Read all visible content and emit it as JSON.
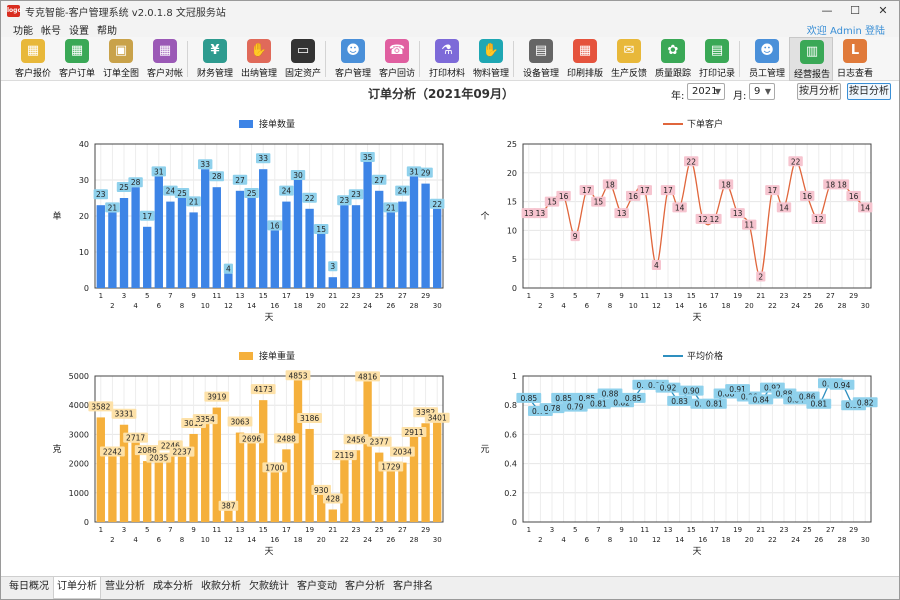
{
  "window": {
    "title": "专克智能-客户管理系统 v2.0.1.8 文冠服务站",
    "logo": "logo"
  },
  "menu": {
    "items": [
      "功能",
      "帐号",
      "设置",
      "帮助"
    ],
    "welcome": "欢迎 Admin 登陆"
  },
  "toolbar": [
    {
      "label": "客户报价",
      "icon": "quote-icon",
      "color": "#e8b83a",
      "glyph": "▦"
    },
    {
      "label": "客户订单",
      "icon": "order-icon",
      "color": "#3aa856",
      "glyph": "▦"
    },
    {
      "label": "订单全图",
      "icon": "image-icon",
      "color": "#c9a24a",
      "glyph": "▣"
    },
    {
      "label": "客户对帐",
      "icon": "ledger-icon",
      "color": "#9b59b6",
      "glyph": "▦"
    },
    {
      "label": "财务管理",
      "icon": "finance-icon",
      "color": "#2e9b8f",
      "glyph": "¥"
    },
    {
      "label": "出纳管理",
      "icon": "cashier-icon",
      "color": "#e06a5a",
      "glyph": "✋"
    },
    {
      "label": "固定资产",
      "icon": "asset-icon",
      "color": "#333333",
      "glyph": "▭"
    },
    {
      "label": "客户管理",
      "icon": "customer-icon",
      "color": "#4a90d9",
      "glyph": "☻"
    },
    {
      "label": "客户回访",
      "icon": "visit-icon",
      "color": "#e05fa0",
      "glyph": "☎"
    },
    {
      "label": "打印材料",
      "icon": "flask-icon",
      "color": "#7d6ad8",
      "glyph": "⚗"
    },
    {
      "label": "物料管理",
      "icon": "glove-icon",
      "color": "#1fa7b3",
      "glyph": "✋"
    },
    {
      "label": "设备管理",
      "icon": "device-icon",
      "color": "#666666",
      "glyph": "▤"
    },
    {
      "label": "印刷排版",
      "icon": "layout-icon",
      "color": "#e5533d",
      "glyph": "▦"
    },
    {
      "label": "生产反馈",
      "icon": "feedback-icon",
      "color": "#e8b83a",
      "glyph": "✉"
    },
    {
      "label": "质量跟踪",
      "icon": "quality-icon",
      "color": "#3aa856",
      "glyph": "✿"
    },
    {
      "label": "打印记录",
      "icon": "record-icon",
      "color": "#3aa856",
      "glyph": "▤"
    },
    {
      "label": "员工管理",
      "icon": "staff-icon",
      "color": "#4a90d9",
      "glyph": "☻"
    },
    {
      "label": "经营报告",
      "icon": "report-icon",
      "color": "#3aa856",
      "glyph": "▥"
    },
    {
      "label": "日志查看",
      "icon": "log-icon",
      "color": "#e07a3a",
      "glyph": "L"
    }
  ],
  "page": {
    "title": "订单分析（2021年09月）",
    "year_label": "年:",
    "year_value": "2021",
    "month_label": "月:",
    "month_value": "9",
    "btn_month": "按月分析",
    "btn_day": "按日分析"
  },
  "tabs": [
    "每日概况",
    "订单分析",
    "营业分析",
    "成本分析",
    "收款分析",
    "欠款统计",
    "客户变动",
    "客户分析",
    "客户排名"
  ],
  "colors": {
    "orders": "#3d84e6",
    "customers": "#e0663c",
    "weight": "#f5b03c",
    "price": "#2e8fbf",
    "label_blue": "#8fd1ec",
    "label_pink": "#f6c4cf",
    "label_orange": "#fde1a8",
    "active_tab": "#ffffff"
  },
  "chart_data": [
    {
      "type": "bar",
      "title": "",
      "legend": "接单数量",
      "xlabel": "天",
      "ylabel": "单",
      "ylim": [
        0,
        40
      ],
      "yticks": [
        0,
        10,
        20,
        30,
        40
      ],
      "x": [
        1,
        2,
        3,
        4,
        5,
        6,
        7,
        8,
        9,
        10,
        11,
        12,
        13,
        14,
        15,
        16,
        17,
        18,
        19,
        20,
        21,
        22,
        23,
        24,
        25,
        26,
        27,
        28,
        29,
        30
      ],
      "values": [
        23,
        21,
        25,
        28,
        17,
        31,
        24,
        25,
        21,
        33,
        28,
        4,
        27,
        25,
        33,
        16,
        24,
        30,
        22,
        15,
        3,
        23,
        23,
        35,
        27,
        21,
        24,
        31,
        29,
        22
      ]
    },
    {
      "type": "line",
      "title": "",
      "legend": "下单客户",
      "xlabel": "天",
      "ylabel": "个",
      "ylim": [
        0,
        25
      ],
      "yticks": [
        0,
        5,
        10,
        15,
        20,
        25
      ],
      "x": [
        1,
        2,
        3,
        4,
        5,
        6,
        7,
        8,
        9,
        10,
        11,
        12,
        13,
        14,
        15,
        16,
        17,
        18,
        19,
        20,
        21,
        22,
        23,
        24,
        25,
        26,
        27,
        28,
        29,
        30
      ],
      "values": [
        13,
        13,
        15,
        16,
        9,
        17,
        15,
        18,
        13,
        16,
        17,
        4,
        17,
        14,
        22,
        12,
        12,
        18,
        13,
        11,
        2,
        17,
        14,
        22,
        16,
        12,
        18,
        18,
        16,
        14
      ]
    },
    {
      "type": "bar",
      "title": "",
      "legend": "接单重量",
      "xlabel": "天",
      "ylabel": "克",
      "ylim": [
        0,
        5000
      ],
      "yticks": [
        0,
        1000,
        2000,
        3000,
        4000,
        5000
      ],
      "x": [
        1,
        2,
        3,
        4,
        5,
        6,
        7,
        8,
        9,
        10,
        11,
        12,
        13,
        14,
        15,
        16,
        17,
        18,
        19,
        20,
        21,
        22,
        23,
        24,
        25,
        26,
        27,
        28,
        29,
        30
      ],
      "values": [
        3582,
        2242,
        3331,
        2717,
        2086,
        2035,
        2246,
        2237,
        3015,
        3354,
        3919,
        387,
        3063,
        2696,
        4173,
        1700,
        2488,
        4853,
        3186,
        930,
        428,
        2119,
        2456,
        4816,
        2377,
        1729,
        2034,
        2911,
        3382,
        3401
      ]
    },
    {
      "type": "line",
      "title": "",
      "legend": "平均价格",
      "xlabel": "天",
      "ylabel": "元",
      "ylim": [
        0,
        1
      ],
      "yticks": [
        0,
        0.2,
        0.4,
        0.6,
        0.8,
        1
      ],
      "x": [
        1,
        2,
        3,
        4,
        5,
        6,
        7,
        8,
        9,
        10,
        11,
        12,
        13,
        14,
        15,
        16,
        17,
        18,
        19,
        20,
        21,
        22,
        23,
        24,
        25,
        26,
        27,
        28,
        29,
        30
      ],
      "values": [
        0.85,
        0.76,
        0.78,
        0.85,
        0.79,
        0.85,
        0.81,
        0.88,
        0.82,
        0.85,
        0.94,
        0.94,
        0.92,
        0.83,
        0.9,
        0.81,
        0.81,
        0.88,
        0.91,
        0.86,
        0.84,
        0.92,
        0.88,
        0.84,
        0.86,
        0.81,
        0.95,
        0.94,
        0.8,
        0.82
      ]
    }
  ]
}
